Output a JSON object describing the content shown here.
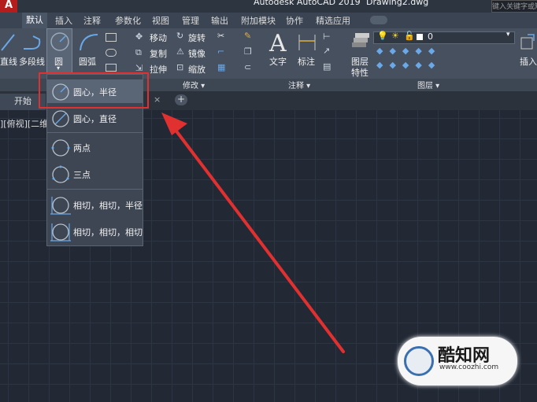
{
  "titlebar": {
    "app_title": "Autodesk AutoCAD 2019",
    "document": "Drawing2.dwg",
    "search_placeholder": "键入关键字或短语",
    "app_logo": "A"
  },
  "ribbon_tabs": [
    "默认",
    "插入",
    "注释",
    "参数化",
    "视图",
    "管理",
    "输出",
    "附加模块",
    "协作",
    "精选应用"
  ],
  "ribbon": {
    "draw": {
      "line": "直线",
      "polyline": "多段线",
      "circle": "圆",
      "arc": "圆弧"
    },
    "modify": {
      "move": "移动",
      "rotate": "旋转",
      "copy": "复制",
      "mirror": "镜像",
      "stretch": "拉伸",
      "scale": "缩放"
    },
    "annotation": {
      "text": "文字",
      "dimension": "标注"
    },
    "layers": {
      "layer_props": "图层",
      "layer_props2": "特性",
      "layer_value": "0"
    },
    "block": {
      "insert": "插入"
    },
    "panels": {
      "modify": "修改 ▾",
      "annotation": "注释 ▾",
      "layers": "图层 ▾"
    }
  },
  "filetabs": {
    "start": "开始",
    "close": "×",
    "plus": "+"
  },
  "viewport_label": "][俯视][二维",
  "circle_menu": [
    {
      "label": "圆心，半径",
      "icon": "circle-center-radius-icon"
    },
    {
      "label": "圆心，直径",
      "icon": "circle-center-diameter-icon"
    },
    {
      "label": "两点",
      "icon": "circle-2point-icon"
    },
    {
      "label": "三点",
      "icon": "circle-3point-icon"
    },
    {
      "label": "相切，相切，半径",
      "icon": "circle-ttr-icon"
    },
    {
      "label": "相切，相切，相切",
      "icon": "circle-ttt-icon"
    }
  ],
  "watermark": {
    "text": "酷知网",
    "url": "www.coozhi.com"
  },
  "colors": {
    "highlight": "#e03030",
    "arrow": "#e03030",
    "canvas": "#222935"
  }
}
